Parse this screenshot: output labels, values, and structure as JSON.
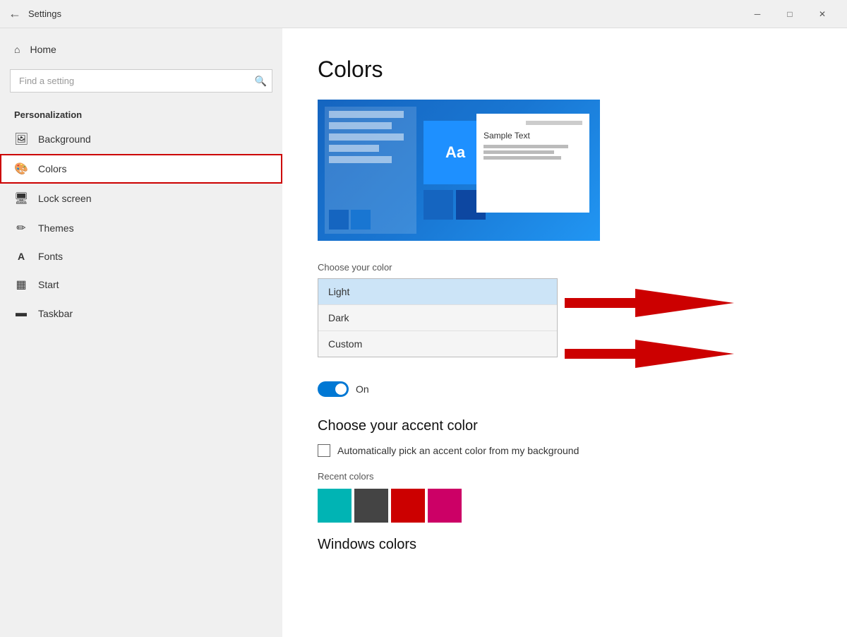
{
  "titlebar": {
    "back_icon": "←",
    "title": "Settings",
    "minimize_icon": "─",
    "maximize_icon": "□",
    "close_icon": "✕"
  },
  "sidebar": {
    "home_label": "Home",
    "search_placeholder": "Find a setting",
    "section_label": "Personalization",
    "items": [
      {
        "id": "background",
        "label": "Background",
        "icon": "🖼"
      },
      {
        "id": "colors",
        "label": "Colors",
        "icon": "🎨",
        "active": true
      },
      {
        "id": "lockscreen",
        "label": "Lock screen",
        "icon": "🖥"
      },
      {
        "id": "themes",
        "label": "Themes",
        "icon": "✏"
      },
      {
        "id": "fonts",
        "label": "Fonts",
        "icon": "A"
      },
      {
        "id": "start",
        "label": "Start",
        "icon": "▦"
      },
      {
        "id": "taskbar",
        "label": "Taskbar",
        "icon": "▬"
      }
    ]
  },
  "content": {
    "page_title": "Colors",
    "preview_sample_text": "Sample Text",
    "preview_aa": "Aa",
    "choose_color_label": "Choose your color",
    "dropdown_options": [
      {
        "id": "light",
        "label": "Light",
        "selected": true
      },
      {
        "id": "dark",
        "label": "Dark",
        "selected": false
      },
      {
        "id": "custom",
        "label": "Custom",
        "selected": false
      }
    ],
    "toggle_label": "On",
    "accent_title": "Choose your accent color",
    "checkbox_label": "Automatically pick an accent color from my background",
    "recent_colors_label": "Recent colors",
    "recent_colors": [
      {
        "hex": "#00b4b4"
      },
      {
        "hex": "#444444"
      },
      {
        "hex": "#cc0000"
      },
      {
        "hex": "#cc0066"
      }
    ],
    "windows_colors_label": "Windows colors"
  }
}
